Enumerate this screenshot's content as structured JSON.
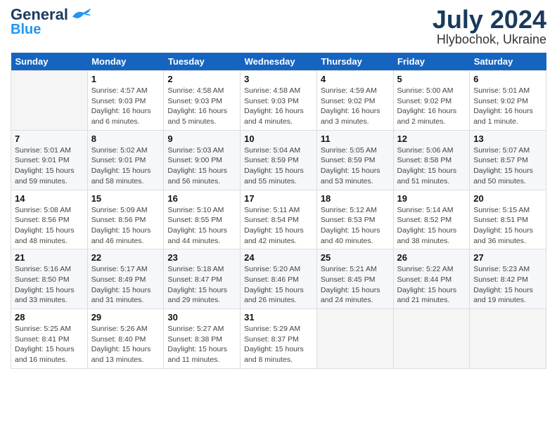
{
  "header": {
    "logo_line1": "General",
    "logo_line2": "Blue",
    "month": "July 2024",
    "location": "Hlybochok, Ukraine"
  },
  "days_of_week": [
    "Sunday",
    "Monday",
    "Tuesday",
    "Wednesday",
    "Thursday",
    "Friday",
    "Saturday"
  ],
  "weeks": [
    [
      {
        "day": "",
        "sunrise": "",
        "sunset": "",
        "daylight": "",
        "empty": true
      },
      {
        "day": "1",
        "sunrise": "Sunrise: 4:57 AM",
        "sunset": "Sunset: 9:03 PM",
        "daylight": "Daylight: 16 hours and 6 minutes."
      },
      {
        "day": "2",
        "sunrise": "Sunrise: 4:58 AM",
        "sunset": "Sunset: 9:03 PM",
        "daylight": "Daylight: 16 hours and 5 minutes."
      },
      {
        "day": "3",
        "sunrise": "Sunrise: 4:58 AM",
        "sunset": "Sunset: 9:03 PM",
        "daylight": "Daylight: 16 hours and 4 minutes."
      },
      {
        "day": "4",
        "sunrise": "Sunrise: 4:59 AM",
        "sunset": "Sunset: 9:02 PM",
        "daylight": "Daylight: 16 hours and 3 minutes."
      },
      {
        "day": "5",
        "sunrise": "Sunrise: 5:00 AM",
        "sunset": "Sunset: 9:02 PM",
        "daylight": "Daylight: 16 hours and 2 minutes."
      },
      {
        "day": "6",
        "sunrise": "Sunrise: 5:01 AM",
        "sunset": "Sunset: 9:02 PM",
        "daylight": "Daylight: 16 hours and 1 minute."
      }
    ],
    [
      {
        "day": "7",
        "sunrise": "Sunrise: 5:01 AM",
        "sunset": "Sunset: 9:01 PM",
        "daylight": "Daylight: 15 hours and 59 minutes."
      },
      {
        "day": "8",
        "sunrise": "Sunrise: 5:02 AM",
        "sunset": "Sunset: 9:01 PM",
        "daylight": "Daylight: 15 hours and 58 minutes."
      },
      {
        "day": "9",
        "sunrise": "Sunrise: 5:03 AM",
        "sunset": "Sunset: 9:00 PM",
        "daylight": "Daylight: 15 hours and 56 minutes."
      },
      {
        "day": "10",
        "sunrise": "Sunrise: 5:04 AM",
        "sunset": "Sunset: 8:59 PM",
        "daylight": "Daylight: 15 hours and 55 minutes."
      },
      {
        "day": "11",
        "sunrise": "Sunrise: 5:05 AM",
        "sunset": "Sunset: 8:59 PM",
        "daylight": "Daylight: 15 hours and 53 minutes."
      },
      {
        "day": "12",
        "sunrise": "Sunrise: 5:06 AM",
        "sunset": "Sunset: 8:58 PM",
        "daylight": "Daylight: 15 hours and 51 minutes."
      },
      {
        "day": "13",
        "sunrise": "Sunrise: 5:07 AM",
        "sunset": "Sunset: 8:57 PM",
        "daylight": "Daylight: 15 hours and 50 minutes."
      }
    ],
    [
      {
        "day": "14",
        "sunrise": "Sunrise: 5:08 AM",
        "sunset": "Sunset: 8:56 PM",
        "daylight": "Daylight: 15 hours and 48 minutes."
      },
      {
        "day": "15",
        "sunrise": "Sunrise: 5:09 AM",
        "sunset": "Sunset: 8:56 PM",
        "daylight": "Daylight: 15 hours and 46 minutes."
      },
      {
        "day": "16",
        "sunrise": "Sunrise: 5:10 AM",
        "sunset": "Sunset: 8:55 PM",
        "daylight": "Daylight: 15 hours and 44 minutes."
      },
      {
        "day": "17",
        "sunrise": "Sunrise: 5:11 AM",
        "sunset": "Sunset: 8:54 PM",
        "daylight": "Daylight: 15 hours and 42 minutes."
      },
      {
        "day": "18",
        "sunrise": "Sunrise: 5:12 AM",
        "sunset": "Sunset: 8:53 PM",
        "daylight": "Daylight: 15 hours and 40 minutes."
      },
      {
        "day": "19",
        "sunrise": "Sunrise: 5:14 AM",
        "sunset": "Sunset: 8:52 PM",
        "daylight": "Daylight: 15 hours and 38 minutes."
      },
      {
        "day": "20",
        "sunrise": "Sunrise: 5:15 AM",
        "sunset": "Sunset: 8:51 PM",
        "daylight": "Daylight: 15 hours and 36 minutes."
      }
    ],
    [
      {
        "day": "21",
        "sunrise": "Sunrise: 5:16 AM",
        "sunset": "Sunset: 8:50 PM",
        "daylight": "Daylight: 15 hours and 33 minutes."
      },
      {
        "day": "22",
        "sunrise": "Sunrise: 5:17 AM",
        "sunset": "Sunset: 8:49 PM",
        "daylight": "Daylight: 15 hours and 31 minutes."
      },
      {
        "day": "23",
        "sunrise": "Sunrise: 5:18 AM",
        "sunset": "Sunset: 8:47 PM",
        "daylight": "Daylight: 15 hours and 29 minutes."
      },
      {
        "day": "24",
        "sunrise": "Sunrise: 5:20 AM",
        "sunset": "Sunset: 8:46 PM",
        "daylight": "Daylight: 15 hours and 26 minutes."
      },
      {
        "day": "25",
        "sunrise": "Sunrise: 5:21 AM",
        "sunset": "Sunset: 8:45 PM",
        "daylight": "Daylight: 15 hours and 24 minutes."
      },
      {
        "day": "26",
        "sunrise": "Sunrise: 5:22 AM",
        "sunset": "Sunset: 8:44 PM",
        "daylight": "Daylight: 15 hours and 21 minutes."
      },
      {
        "day": "27",
        "sunrise": "Sunrise: 5:23 AM",
        "sunset": "Sunset: 8:42 PM",
        "daylight": "Daylight: 15 hours and 19 minutes."
      }
    ],
    [
      {
        "day": "28",
        "sunrise": "Sunrise: 5:25 AM",
        "sunset": "Sunset: 8:41 PM",
        "daylight": "Daylight: 15 hours and 16 minutes."
      },
      {
        "day": "29",
        "sunrise": "Sunrise: 5:26 AM",
        "sunset": "Sunset: 8:40 PM",
        "daylight": "Daylight: 15 hours and 13 minutes."
      },
      {
        "day": "30",
        "sunrise": "Sunrise: 5:27 AM",
        "sunset": "Sunset: 8:38 PM",
        "daylight": "Daylight: 15 hours and 11 minutes."
      },
      {
        "day": "31",
        "sunrise": "Sunrise: 5:29 AM",
        "sunset": "Sunset: 8:37 PM",
        "daylight": "Daylight: 15 hours and 8 minutes."
      },
      {
        "day": "",
        "sunrise": "",
        "sunset": "",
        "daylight": "",
        "empty": true
      },
      {
        "day": "",
        "sunrise": "",
        "sunset": "",
        "daylight": "",
        "empty": true
      },
      {
        "day": "",
        "sunrise": "",
        "sunset": "",
        "daylight": "",
        "empty": true
      }
    ]
  ]
}
